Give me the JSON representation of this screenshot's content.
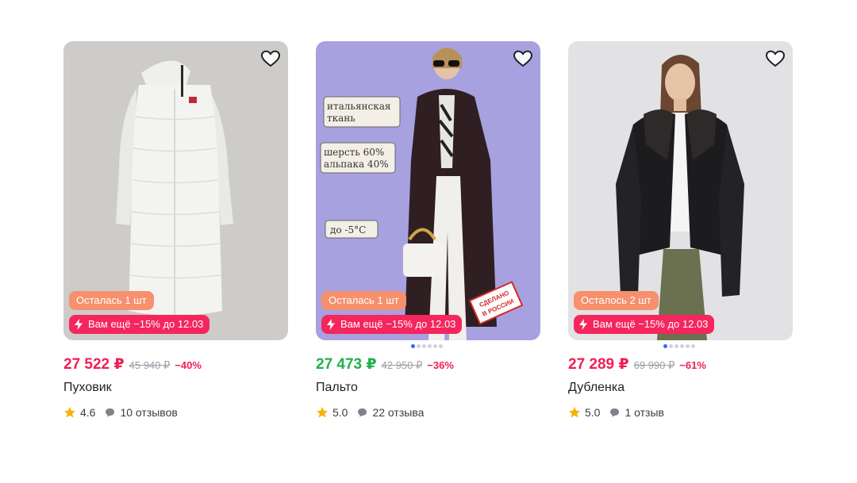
{
  "colors": {
    "price_red": "#f01f57",
    "price_green": "#20b14a",
    "stock_badge": "#f7906d",
    "promo_badge": "#f5265e",
    "star": "#f6b100"
  },
  "products": [
    {
      "image": "white long puffer coat on grey background",
      "stock_label": "Осталась 1 шт",
      "promo_label": "Вам ещё −15% до 12.03",
      "price": "27 522 ₽",
      "price_color": "#f01f57",
      "old_price": "45 940 ₽",
      "discount": "−40%",
      "name": "Пуховик",
      "rating": "4.6",
      "reviews": "10 отзывов",
      "has_dots": false
    },
    {
      "image": "woman in dark long coat on lilac background",
      "stock_label": "Осталась 1 шт",
      "promo_label": "Вам ещё −15% до 12.03",
      "price": "27 473 ₽",
      "price_color": "#20b14a",
      "old_price": "42 950 ₽",
      "discount": "−36%",
      "name": "Пальто",
      "rating": "5.0",
      "reviews": "22 отзыва",
      "has_dots": true,
      "callouts": [
        "итальянская",
        "ткань",
        "шерсть 60%",
        "альпака 40%",
        "до -5°C"
      ],
      "stamp": [
        "СДЕЛАНО",
        "В РОССИИ"
      ]
    },
    {
      "image": "woman in black sheepskin jacket on light grey background",
      "stock_label": "Осталось 2 шт",
      "promo_label": "Вам ещё −15% до 12.03",
      "price": "27 289 ₽",
      "price_color": "#f01f57",
      "old_price": "69 990 ₽",
      "discount": "−61%",
      "name": "Дубленка",
      "rating": "5.0",
      "reviews": "1 отзыв",
      "has_dots": true
    }
  ]
}
